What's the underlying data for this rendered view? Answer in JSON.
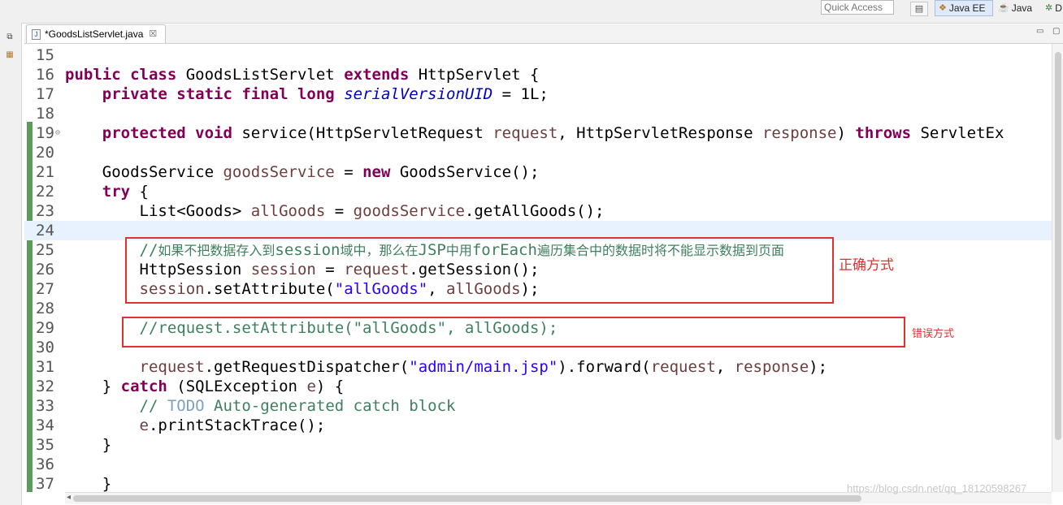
{
  "toolbar": {
    "quick_access_placeholder": "Quick Access",
    "perspectives": [
      {
        "label": "Java EE",
        "active": true,
        "icon": "java-ee-perspective-icon"
      },
      {
        "label": "Java",
        "active": false,
        "icon": "java-perspective-icon"
      },
      {
        "label": "D",
        "active": false,
        "icon": "debug-perspective-icon"
      }
    ]
  },
  "tab": {
    "label": "*GoodsListServlet.java",
    "close": "☒"
  },
  "code_lines": [
    {
      "n": "15",
      "segs": []
    },
    {
      "n": "16",
      "segs": [
        [
          "kw",
          "public class "
        ],
        [
          "p",
          "GoodsListServlet "
        ],
        [
          "kw",
          "extends "
        ],
        [
          "p",
          "HttpServlet {"
        ]
      ]
    },
    {
      "n": "17",
      "segs": [
        [
          "p",
          "    "
        ],
        [
          "kw",
          "private static final long "
        ],
        [
          "fld",
          "serialVersionUID"
        ],
        [
          "p",
          " = 1L;"
        ]
      ]
    },
    {
      "n": "18",
      "segs": []
    },
    {
      "n": "19",
      "segs": [
        [
          "p",
          "    "
        ],
        [
          "kw",
          "protected void "
        ],
        [
          "p",
          "service(HttpServletRequest "
        ],
        [
          "pv",
          "request"
        ],
        [
          "p",
          ", HttpServletResponse "
        ],
        [
          "pv",
          "response"
        ],
        [
          "p",
          ") "
        ],
        [
          "kw",
          "throws "
        ],
        [
          "p",
          "ServletEx"
        ]
      ]
    },
    {
      "n": "20",
      "segs": []
    },
    {
      "n": "21",
      "segs": [
        [
          "p",
          "    GoodsService "
        ],
        [
          "pv",
          "goodsService"
        ],
        [
          "p",
          " = "
        ],
        [
          "kw",
          "new "
        ],
        [
          "p",
          "GoodsService();"
        ]
      ]
    },
    {
      "n": "22",
      "segs": [
        [
          "p",
          "    "
        ],
        [
          "kw",
          "try "
        ],
        [
          "p",
          "{"
        ]
      ]
    },
    {
      "n": "23",
      "segs": [
        [
          "p",
          "        List<Goods> "
        ],
        [
          "pv",
          "allGoods"
        ],
        [
          "p",
          " = "
        ],
        [
          "pv",
          "goodsService"
        ],
        [
          "p",
          ".getAllGoods();"
        ]
      ]
    },
    {
      "n": "24",
      "segs": []
    },
    {
      "n": "25",
      "segs": [
        [
          "p",
          "        "
        ],
        [
          "cm",
          "//"
        ],
        [
          "cmcjk",
          "如果不把数据存入到"
        ],
        [
          "cm",
          "session"
        ],
        [
          "cmcjk",
          "域中，那么在"
        ],
        [
          "cm",
          "JSP"
        ],
        [
          "cmcjk",
          "中用"
        ],
        [
          "cm",
          "forEach"
        ],
        [
          "cmcjk",
          "遍历集合中的数据时将不能显示数据到页面"
        ]
      ]
    },
    {
      "n": "26",
      "segs": [
        [
          "p",
          "        HttpSession "
        ],
        [
          "pv",
          "session"
        ],
        [
          "p",
          " = "
        ],
        [
          "pv",
          "request"
        ],
        [
          "p",
          ".getSession();"
        ]
      ]
    },
    {
      "n": "27",
      "segs": [
        [
          "p",
          "        "
        ],
        [
          "pv",
          "session"
        ],
        [
          "p",
          ".setAttribute("
        ],
        [
          "str",
          "\"allGoods\""
        ],
        [
          "p",
          ", "
        ],
        [
          "pv",
          "allGoods"
        ],
        [
          "p",
          ");"
        ]
      ]
    },
    {
      "n": "28",
      "segs": []
    },
    {
      "n": "29",
      "segs": [
        [
          "p",
          "        "
        ],
        [
          "cm",
          "//request.setAttribute(\"allGoods\", allGoods);"
        ]
      ]
    },
    {
      "n": "30",
      "segs": []
    },
    {
      "n": "31",
      "segs": [
        [
          "p",
          "        "
        ],
        [
          "pv",
          "request"
        ],
        [
          "p",
          ".getRequestDispatcher("
        ],
        [
          "str",
          "\"admin/main.jsp\""
        ],
        [
          "p",
          ").forward("
        ],
        [
          "pv",
          "request"
        ],
        [
          "p",
          ", "
        ],
        [
          "pv",
          "response"
        ],
        [
          "p",
          ");"
        ]
      ]
    },
    {
      "n": "32",
      "segs": [
        [
          "p",
          "    } "
        ],
        [
          "kw",
          "catch "
        ],
        [
          "p",
          "(SQLException "
        ],
        [
          "pv",
          "e"
        ],
        [
          "p",
          ") {"
        ]
      ]
    },
    {
      "n": "33",
      "segs": [
        [
          "p",
          "        "
        ],
        [
          "cm",
          "// "
        ],
        [
          "todo",
          "TODO"
        ],
        [
          "cm",
          " Auto-generated catch block"
        ]
      ]
    },
    {
      "n": "34",
      "segs": [
        [
          "p",
          "        "
        ],
        [
          "pv",
          "e"
        ],
        [
          "p",
          ".printStackTrace();"
        ]
      ]
    },
    {
      "n": "35",
      "segs": [
        [
          "p",
          "    }"
        ]
      ]
    },
    {
      "n": "36",
      "segs": []
    },
    {
      "n": "37",
      "segs": [
        [
          "p",
          "    }"
        ]
      ]
    }
  ],
  "annotations": {
    "correct_label": "正确方式",
    "wrong_label": "错误方式"
  },
  "watermark": "https://blog.csdn.net/qq_18120598267"
}
